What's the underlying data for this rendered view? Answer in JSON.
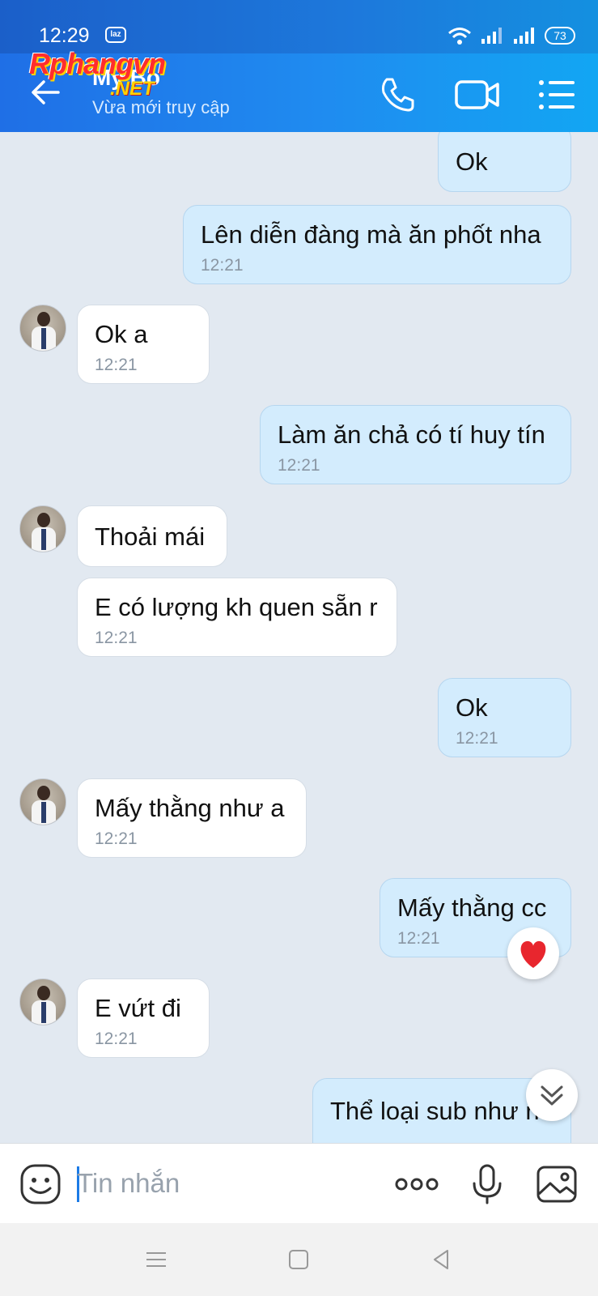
{
  "status_bar": {
    "time": "12:29",
    "notification_badge": "laz",
    "battery": "73"
  },
  "header": {
    "contact_name": "My Bo",
    "contact_status": "Vừa mới truy cập",
    "watermark_main": "Rphangvn",
    "watermark_sub": ".NET",
    "icons": [
      "back-arrow-icon",
      "phone-icon",
      "video-call-icon",
      "menu-list-icon"
    ]
  },
  "messages": [
    {
      "side": "out",
      "text": "Ok",
      "time": ""
    },
    {
      "side": "out",
      "text": "Lên diễn đàng mà ăn phốt nha",
      "time": "12:21"
    },
    {
      "side": "in",
      "text": "Ok a",
      "time": "12:21"
    },
    {
      "side": "out",
      "text": "Làm ăn chả có tí huy tín",
      "time": "12:21"
    },
    {
      "side": "in",
      "text": "Thoải mái",
      "time": ""
    },
    {
      "side": "in",
      "text": "E có lượng kh quen sẵn r",
      "time": "12:21"
    },
    {
      "side": "out",
      "text": "Ok",
      "time": "12:21"
    },
    {
      "side": "in",
      "text": "Mấy thằng như a",
      "time": "12:21"
    },
    {
      "side": "out",
      "text": "Mấy thằng cc",
      "time": "12:21",
      "reaction": "heart"
    },
    {
      "side": "in",
      "text": "E vứt đi",
      "time": "12:21"
    },
    {
      "side": "out",
      "text": "Thể loại sub như n",
      "time": ""
    }
  ],
  "input": {
    "placeholder": "Tin nhắn",
    "value": ""
  },
  "colors": {
    "header_gradient_start": "#1f6fe6",
    "header_gradient_end": "#12a6f3",
    "outgoing_bubble": "#d3ecfd",
    "incoming_bubble": "#ffffff",
    "chat_background": "#e2e9f1",
    "reaction_heart": "#e8262e"
  }
}
